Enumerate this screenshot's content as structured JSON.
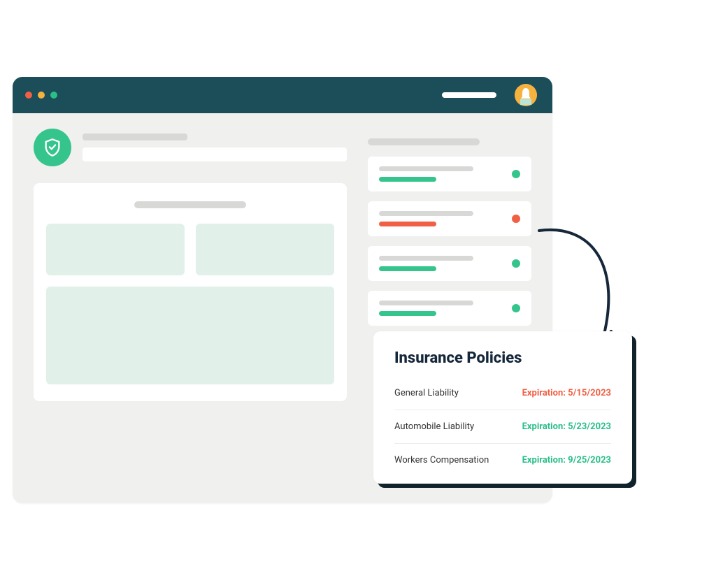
{
  "colors": {
    "header_bg": "#1b4e59",
    "accent_green": "#35c58c",
    "accent_orange": "#f16045",
    "accent_yellow": "#f6b23f",
    "text_dark": "#15273a"
  },
  "titlebar": {
    "traffic_lights": [
      "red",
      "yellow",
      "green"
    ],
    "avatar_icon": "avatar-bell"
  },
  "logo": {
    "icon": "shield-check-icon"
  },
  "sidebar_cards": [
    {
      "status": "green"
    },
    {
      "status": "orange"
    },
    {
      "status": "green"
    },
    {
      "status": "green"
    }
  ],
  "overlay": {
    "title": "Insurance Policies",
    "rows": [
      {
        "name": "General Liability",
        "expiration_label": "Expiration: 5/15/2023",
        "state": "expired"
      },
      {
        "name": "Automobile Liability",
        "expiration_label": "Expiration: 5/23/2023",
        "state": "ok"
      },
      {
        "name": "Workers Compensation",
        "expiration_label": "Expiration: 9/25/2023",
        "state": "ok"
      }
    ]
  }
}
